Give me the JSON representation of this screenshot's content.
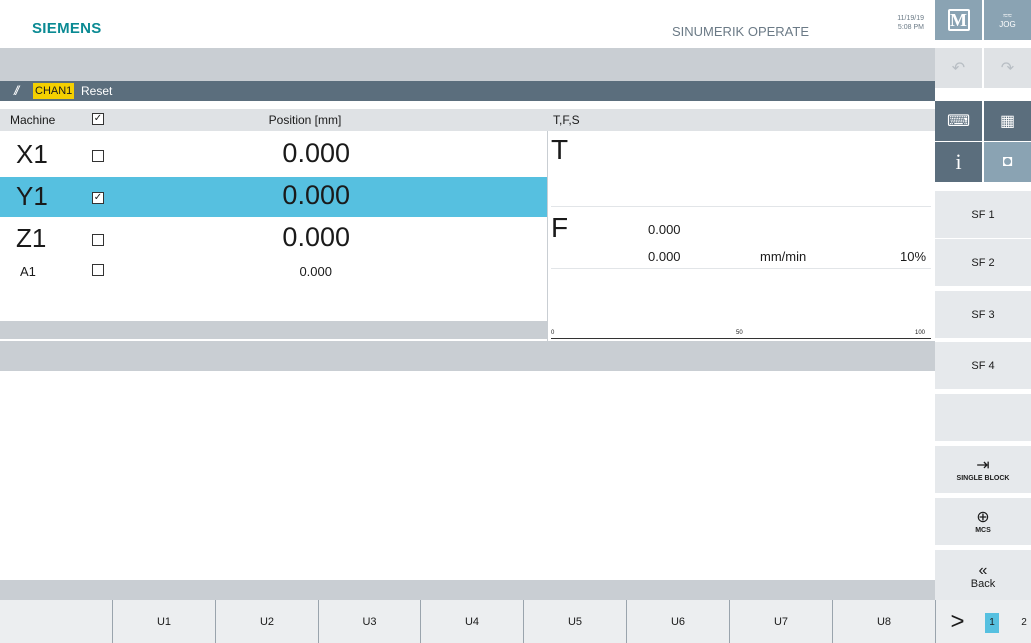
{
  "header": {
    "brand": "SIEMENS",
    "product": "SINUMERIK OPERATE",
    "date": "11/19/19",
    "time": "5:08 PM"
  },
  "channel": {
    "name": "CHAN1",
    "status": "Reset"
  },
  "position_window": {
    "col_machine": "Machine",
    "col_position": "Position [mm]",
    "rows": [
      {
        "axis": "X1",
        "value": "0.000",
        "checked": false
      },
      {
        "axis": "Y1",
        "value": "0.000",
        "checked": true
      },
      {
        "axis": "Z1",
        "value": "0.000",
        "checked": false
      },
      {
        "axis": "A1",
        "value": "0.000",
        "checked": false
      }
    ]
  },
  "tfs": {
    "title": "T,F,S",
    "t_label": "T",
    "f_label": "F",
    "f_value1": "0.000",
    "f_value2": "0.000",
    "f_unit": "mm/min",
    "f_override": "10%",
    "scale": [
      "0",
      "50",
      "100"
    ]
  },
  "right_panel": {
    "m_label": "M",
    "jog_label": "JOG",
    "info_label": "i",
    "sf_buttons": [
      "SF 1",
      "SF 2",
      "SF 3",
      "SF 4"
    ],
    "single_block": "SINGLE BLOCK",
    "mcs": "MCS",
    "back": "Back"
  },
  "bottom_bar": {
    "buttons": [
      "U1",
      "U2",
      "U3",
      "U4",
      "U5",
      "U6",
      "U7",
      "U8"
    ],
    "next": ">",
    "pages": [
      "1",
      "2"
    ]
  },
  "colors": {
    "brand": "#0a8a93",
    "selected_row": "#56c0e0",
    "channel_badge": "#f5d000",
    "dark_bar": "#5b6e7d"
  }
}
